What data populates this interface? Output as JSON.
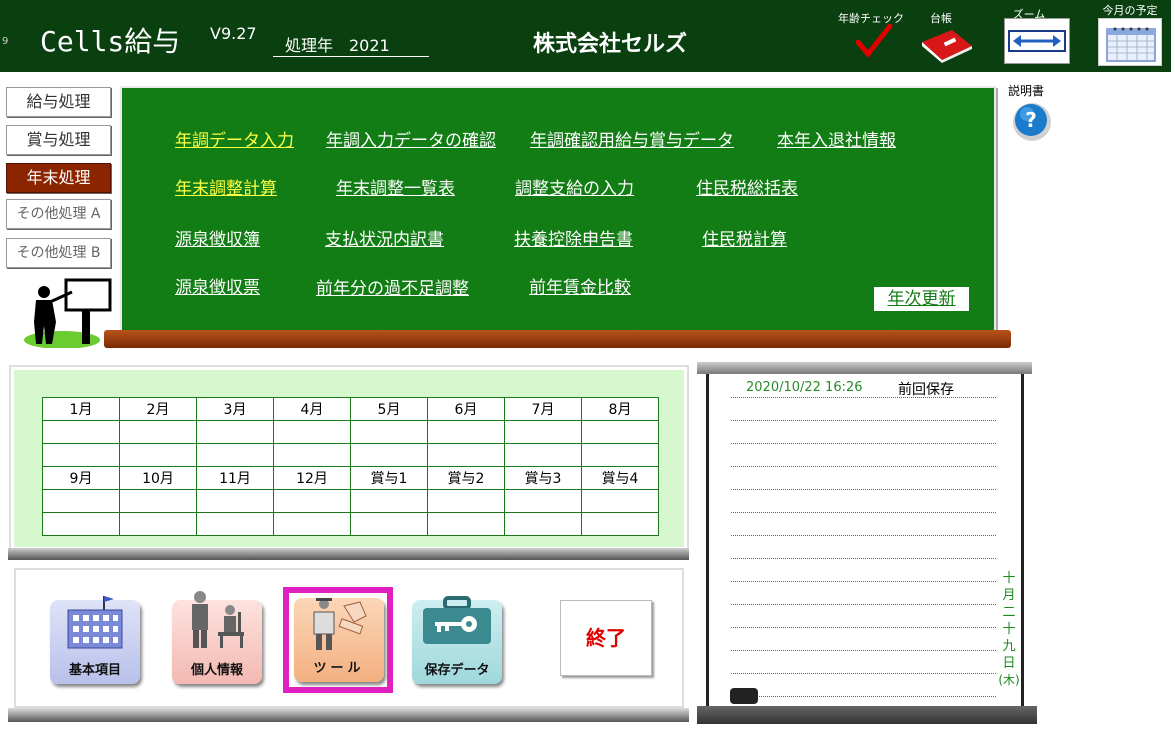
{
  "header": {
    "app_title": "Cells給与",
    "small_mark": "9",
    "version": "V9.27",
    "year_label": "処理年　2021",
    "company": "株式会社セルズ",
    "icons": [
      {
        "label": "年齢チェック",
        "icon": "checkmark-icon"
      },
      {
        "label": "台帳",
        "icon": "ledger-book-icon"
      },
      {
        "label": "ズーム",
        "icon": "zoom-arrows-icon"
      },
      {
        "label": "今月の予定",
        "icon": "calendar-icon"
      }
    ],
    "help_label": "説明書"
  },
  "left_nav": [
    {
      "label": "給与処理",
      "active": false
    },
    {
      "label": "賞与処理",
      "active": false
    },
    {
      "label": "年末処理",
      "active": true
    },
    {
      "label": "その他処理 A",
      "active": false
    },
    {
      "label": "その他処理 B",
      "active": false
    }
  ],
  "menu": {
    "row1": [
      "年調データ入力",
      "年調入力データの確認",
      "年調確認用給与賞与データ",
      "本年入退社情報"
    ],
    "row2": [
      "年末調整計算",
      "年末調整一覧表",
      "調整支給の入力",
      "住民税総括表"
    ],
    "row3": [
      "源泉徴収簿",
      "支払状況内訳書",
      "扶養控除申告書",
      "住民税計算"
    ],
    "row4": [
      "源泉徴収票",
      "前年分の過不足調整",
      "前年賃金比較"
    ],
    "annual_update": "年次更新"
  },
  "calendar": {
    "row1": [
      "1月",
      "2月",
      "3月",
      "4月",
      "5月",
      "6月",
      "7月",
      "8月"
    ],
    "row2": [
      "9月",
      "10月",
      "11月",
      "12月",
      "賞与1",
      "賞与2",
      "賞与3",
      "賞与4"
    ]
  },
  "tools": [
    {
      "label": "基本項目",
      "icon": "building-icon"
    },
    {
      "label": "個人情報",
      "icon": "people-icon"
    },
    {
      "label": "ツール",
      "icon": "tools-icon"
    },
    {
      "label": "保存データ",
      "icon": "toolbox-key-icon"
    }
  ],
  "end_label": "終了",
  "memo": {
    "save_time": "2020/10/22 16:26",
    "save_label": "前回保存",
    "vertical_date": [
      "十",
      "月",
      "二",
      "十",
      "九",
      "日",
      "(木)"
    ]
  },
  "colors": {
    "header_bg": "#0a3f10",
    "menu_panel": "#137d15",
    "active_nav": "#8b2500",
    "end_text": "#e00000",
    "tool_highlight": "#e020c0"
  }
}
